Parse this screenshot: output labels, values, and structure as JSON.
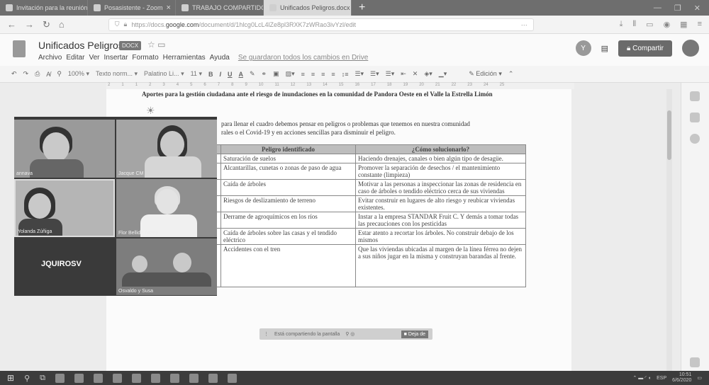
{
  "browser": {
    "tabs": [
      {
        "label": "Invitación para la reunión de …"
      },
      {
        "label": "Posasistente - Zoom"
      },
      {
        "label": "TRABAJO COMPARTIDO TALLE…"
      },
      {
        "label": "Unificados Peligros.docx - Doc…"
      }
    ],
    "url_prefix": "https://docs.",
    "url_domain": "google.com",
    "url_path": "/document/d/1hlcg0LcL4lZe8pl3RXK7zWRao3ivYzl/edit",
    "url_more": "···"
  },
  "docs": {
    "title": "Unificados Peligros",
    "badge": "DOCX",
    "menus": [
      "Archivo",
      "Editar",
      "Ver",
      "Insertar",
      "Formato",
      "Herramientas",
      "Ayuda"
    ],
    "saved_status": "Se guardaron todos los cambios en Drive",
    "user_initial": "Y",
    "share_label": "Compartir"
  },
  "toolbar": {
    "zoom": "100%",
    "style": "Texto norm...",
    "font": "Palatino Li...",
    "size": "11",
    "mode": "Edición"
  },
  "ruler_marks": [
    "2",
    "1",
    "1",
    "2",
    "3",
    "4",
    "5",
    "6",
    "7",
    "8",
    "9",
    "10",
    "11",
    "12",
    "13",
    "14",
    "15",
    "16",
    "17",
    "18",
    "19",
    "20",
    "21",
    "22",
    "23",
    "24",
    "25"
  ],
  "document": {
    "heading": "Aportes para la gestión ciudadana ante el riesgo de inundaciones en la comunidad de Pandora Oeste en el Valle la Estrella Limón",
    "para1": "para llenar el cuadro debemos pensar en peligros o problemas que tenemos en nuestra comunidad",
    "para2": "rales o el Covid-19 y en acciones sencillas para disminuir el peligro.",
    "table": {
      "headers": [
        "",
        "Peligro identificado",
        "¿Cómo solucionarlo?"
      ],
      "rows": [
        [
          "",
          "Saturación de suelos",
          "Haciendo drenajes, canales o bien algún tipo de desagüe."
        ],
        [
          "",
          "Alcantarillas, cunetas o zonas de paso de agua",
          "Promover la separación de desechos / el mantenimiento constante (limpieza)"
        ],
        [
          "",
          "Caída de árboles",
          "Motivar a las personas a inspeccionar las zonas de residencia en caso de árboles o tendido eléctrico cerca de sus viviendas"
        ],
        [
          "",
          "Riesgos de deslizamiento de terreno",
          "Evitar construir en lugares de alto riesgo y reubicar viviendas existentes."
        ],
        [
          "",
          "Derrame de agroquímicos en los ríos",
          "Instar a la empresa STANDAR Fruit C. Y demás a tomar todas las precauciones con los pesticidas"
        ],
        [
          "",
          "Caída de árboles sobre las casas y el tendido eléctrico",
          "Estar atento a recortar los árboles. No construir debajo de los mismos"
        ],
        [
          "",
          "Accidentes con el tren",
          "Que las viviendas ubicadas al margen de la línea férrea no dejen a sus niños jugar en la misma y construyan barandas al frente."
        ]
      ]
    }
  },
  "zoom": {
    "participants": [
      "annava",
      "Jacque CM",
      "Yolanda Zúñiga",
      "Flor Bellido Torres",
      "Osvaldo y Susa"
    ],
    "self_name": "JQUIROSV",
    "share_text": "Está compartiendo la pantalla",
    "stop_label": "Deja de"
  },
  "taskbar": {
    "lang": "ESP",
    "time": "10:51",
    "date": "6/6/2020"
  }
}
